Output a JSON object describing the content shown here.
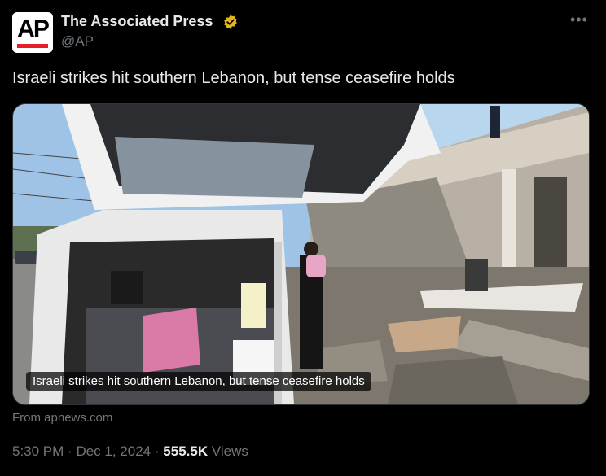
{
  "author": {
    "display_name": "The Associated Press",
    "handle": "@AP",
    "avatar_text": "AP",
    "verified_color": "#e2b719"
  },
  "tweet": {
    "text": "Israeli strikes hit southern Lebanon, but tense ceasefire holds",
    "media_caption": "Israeli strikes hit southern Lebanon, but tense ceasefire holds",
    "source": "From apnews.com",
    "time": "5:30 PM",
    "date": "Dec 1, 2024",
    "separator": "·",
    "views_count": "555.5K",
    "views_label": "Views"
  },
  "icons": {
    "more": "more-options-icon",
    "verified": "verified-badge-icon"
  },
  "colors": {
    "background": "#000000",
    "primary_text": "#e7e9ea",
    "secondary_text": "#71767b",
    "ap_red": "#e61e2a"
  }
}
